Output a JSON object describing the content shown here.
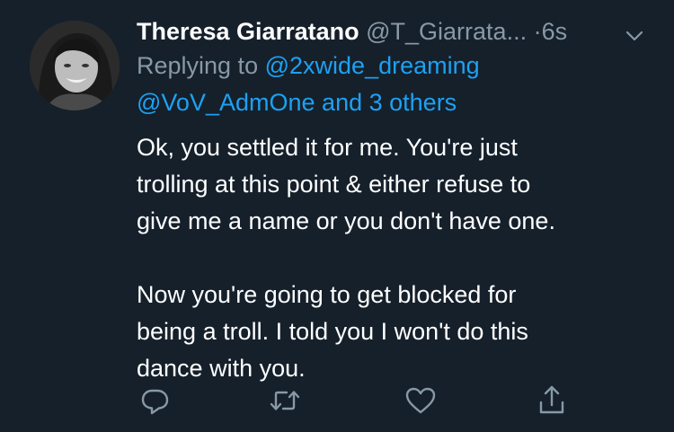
{
  "tweet": {
    "author_name": "Theresa Giarratano",
    "author_handle": "@T_Giarrata...",
    "separator": "·",
    "timestamp": "6s",
    "reply": {
      "prefix": "Replying to",
      "first_mention": "@2xwide_dreaming",
      "second_mention": "@VoV_AdmOne",
      "and_text": "and",
      "others": "3 others"
    },
    "text_lines": [
      "Ok, you settled it for me. You're just",
      "trolling at this point & either refuse to",
      "give me a name or you don't have one.",
      "",
      "Now you're going to get blocked for",
      "being a troll.  I told you I won't do this",
      "dance with you."
    ]
  },
  "icons": {
    "menu": "chevron-down-icon",
    "reply": "reply-icon",
    "retweet": "retweet-icon",
    "like": "heart-icon",
    "share": "share-icon"
  },
  "colors": {
    "background": "#15202b",
    "text": "#ffffff",
    "muted": "#8899a6",
    "link": "#1da1f2"
  }
}
